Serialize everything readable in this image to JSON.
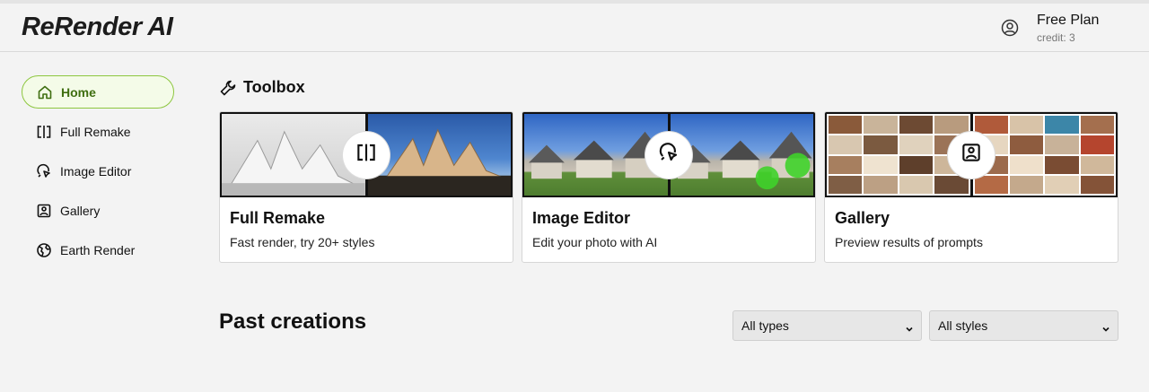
{
  "header": {
    "logo": "ReRender AI",
    "plan": "Free Plan",
    "credit": "credit: 3"
  },
  "sidebar": {
    "items": [
      {
        "label": "Home",
        "icon": "home-icon",
        "active": true
      },
      {
        "label": "Full Remake",
        "icon": "split-frame-icon",
        "active": false
      },
      {
        "label": "Image Editor",
        "icon": "brush-cursor-icon",
        "active": false
      },
      {
        "label": "Gallery",
        "icon": "image-icon",
        "active": false
      },
      {
        "label": "Earth Render",
        "icon": "globe-icon",
        "active": false
      }
    ]
  },
  "toolbox": {
    "title": "Toolbox",
    "icon": "wrench-icon",
    "cards": [
      {
        "title": "Full Remake",
        "desc": "Fast render, try 20+ styles",
        "icon": "split-frame-icon"
      },
      {
        "title": "Image Editor",
        "desc": "Edit your photo with AI",
        "icon": "brush-cursor-icon"
      },
      {
        "title": "Gallery",
        "desc": "Preview results of prompts",
        "icon": "image-icon"
      }
    ]
  },
  "past": {
    "title": "Past creations",
    "type_filter": "All types",
    "style_filter": "All styles"
  },
  "colors": {
    "accent": "#8dc63f",
    "accent_bg": "#f4fbe8",
    "accent_text": "#3f6e10"
  }
}
